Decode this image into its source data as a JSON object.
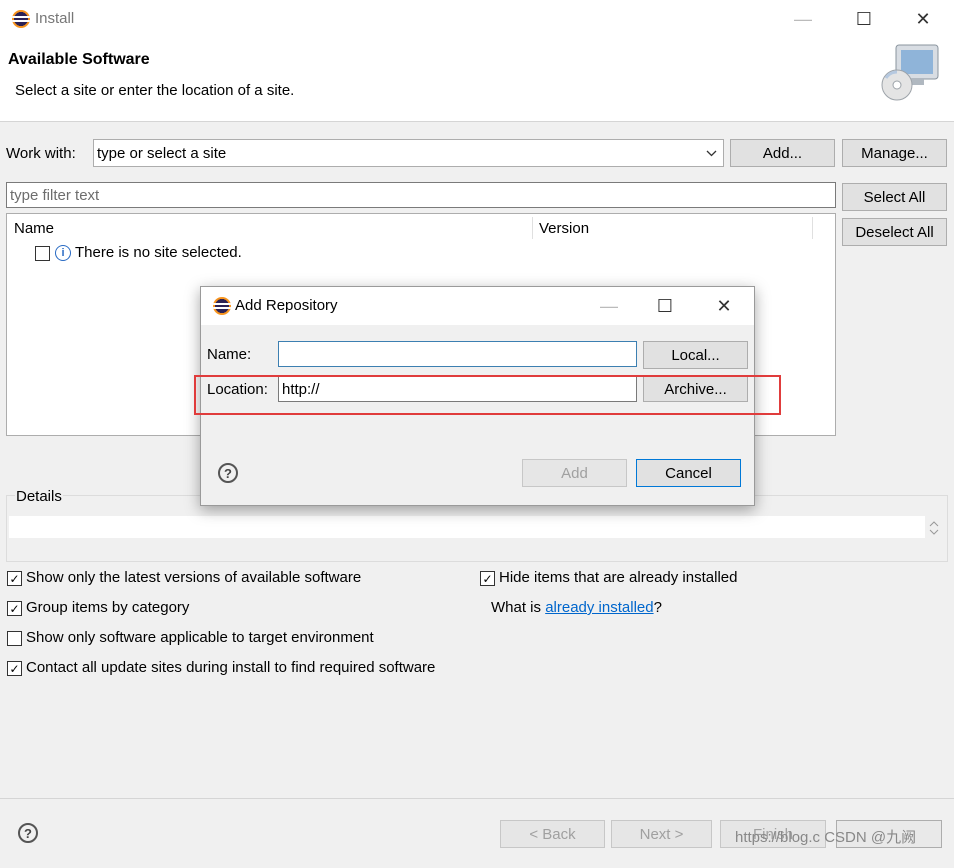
{
  "window": {
    "title": "Install",
    "minimize": "—",
    "maximize": "☐",
    "close": "✕"
  },
  "banner": {
    "title": "Available Software",
    "description": "Select a site or enter the location of a site."
  },
  "work_with": {
    "label": "Work with:",
    "placeholder": "type or select a site",
    "add_label": "Add...",
    "manage_label": "Manage..."
  },
  "filter": {
    "placeholder": "type filter text"
  },
  "side_buttons": {
    "select_all": "Select All",
    "deselect_all": "Deselect All"
  },
  "table": {
    "columns": [
      "Name",
      "Version"
    ],
    "rows": [
      {
        "label": "There is no site selected.",
        "checked": false
      }
    ]
  },
  "details": {
    "label": "Details"
  },
  "options": {
    "show_latest": {
      "label": "Show only the latest versions of available software",
      "checked": true
    },
    "hide_installed": {
      "label": "Hide items that are already installed",
      "checked": true
    },
    "group_by_category": {
      "label": "Group items by category",
      "checked": true
    },
    "what_is_prefix": "What is ",
    "what_is_link": "already installed",
    "what_is_suffix": "?",
    "target_env": {
      "label": "Show only software applicable to target environment",
      "checked": false
    },
    "contact_all": {
      "label": "Contact all update sites during install to find required software",
      "checked": true
    }
  },
  "footer": {
    "back": "< Back",
    "next": "Next >",
    "finish": "Finish"
  },
  "dialog": {
    "title": "Add Repository",
    "name_label": "Name:",
    "name_value": "",
    "location_label": "Location:",
    "location_value": "http://",
    "local_button": "Local...",
    "archive_button": "Archive...",
    "add_button": "Add",
    "cancel_button": "Cancel"
  },
  "watermark": "https://blog.c CSDN @九阙",
  "colors": {
    "highlight": "#e03c3c",
    "link": "#0066cc"
  }
}
